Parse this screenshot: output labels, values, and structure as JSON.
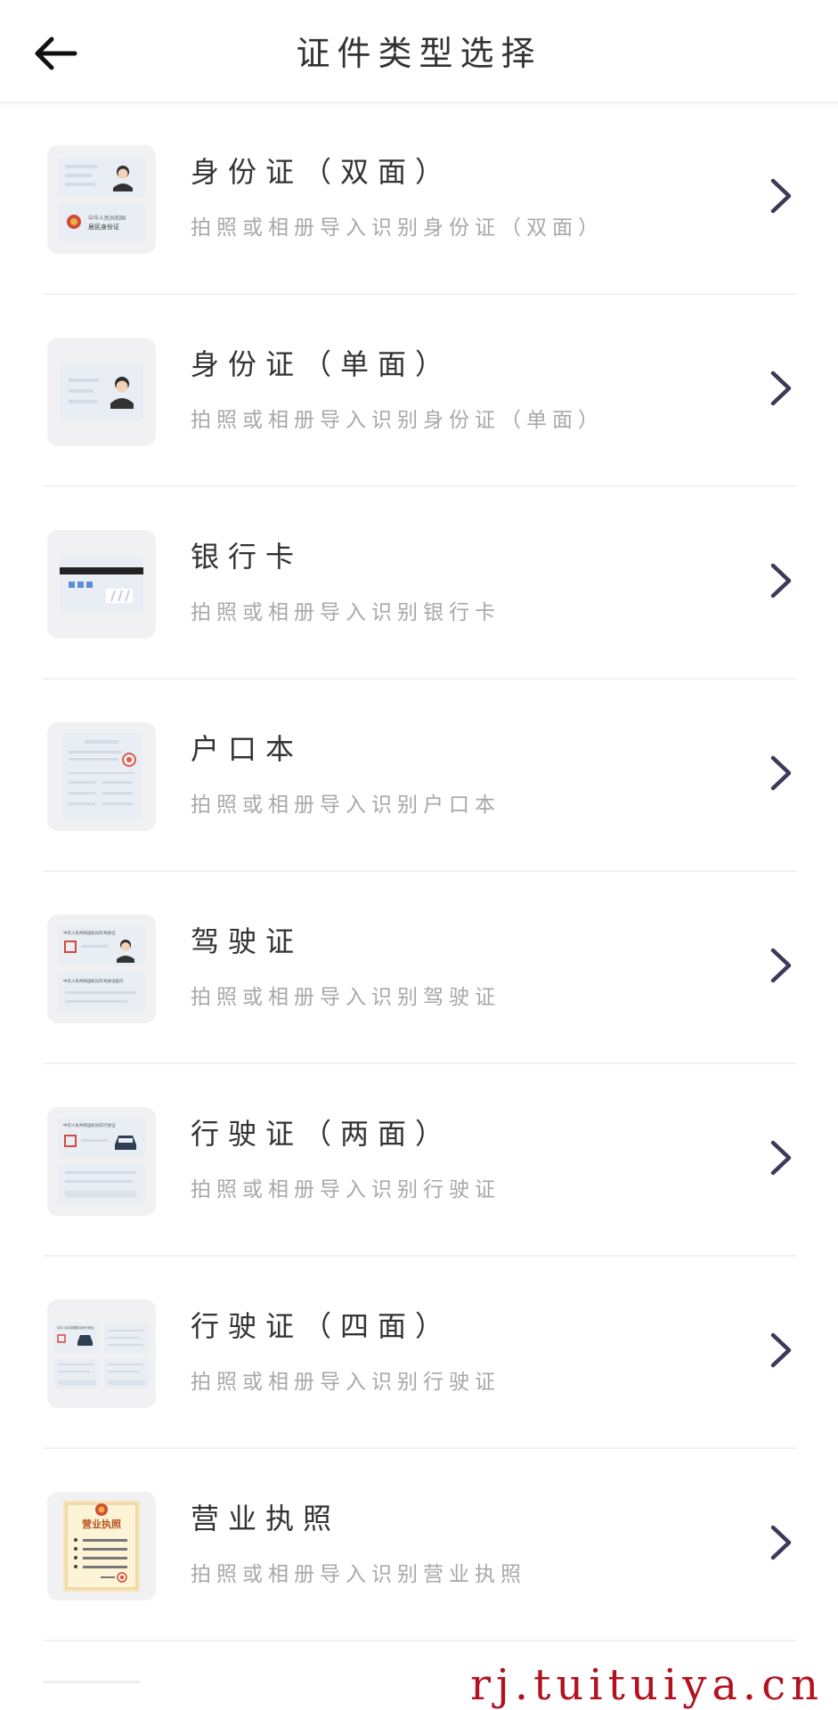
{
  "header": {
    "title": "证件类型选择",
    "back_icon": "arrow-left-icon"
  },
  "items": [
    {
      "id": "id-double",
      "title": "身份证（双面）",
      "subtitle": "拍照或相册导入识别身份证（双面）",
      "icon": "id-card-double-icon"
    },
    {
      "id": "id-single",
      "title": "身份证（单面）",
      "subtitle": "拍照或相册导入识别身份证（单面）",
      "icon": "id-card-single-icon"
    },
    {
      "id": "bank-card",
      "title": "银行卡",
      "subtitle": "拍照或相册导入识别银行卡",
      "icon": "bank-card-icon"
    },
    {
      "id": "household",
      "title": "户口本",
      "subtitle": "拍照或相册导入识别户口本",
      "icon": "household-register-icon"
    },
    {
      "id": "driver-license",
      "title": "驾驶证",
      "subtitle": "拍照或相册导入识别驾驶证",
      "icon": "driver-license-icon"
    },
    {
      "id": "vehicle-two",
      "title": "行驶证（两面）",
      "subtitle": "拍照或相册导入识别行驶证",
      "icon": "vehicle-license-two-icon"
    },
    {
      "id": "vehicle-four",
      "title": "行驶证（四面）",
      "subtitle": "拍照或相册导入识别行驶证",
      "icon": "vehicle-license-four-icon"
    },
    {
      "id": "business",
      "title": "营业执照",
      "subtitle": "拍照或相册导入识别营业执照",
      "icon": "business-license-icon"
    }
  ],
  "thumb_text": {
    "id_front_line1": "中华人民共和国",
    "id_front_line2": "居民身份证",
    "driver_line1": "中华人民共和国机动车驾驶证",
    "driver_line2": "中华人民共和国机动车驾驶证副页",
    "vehicle_line1": "中华人民共和国机动车行驶证",
    "vehicle4_line1": "中华人民共和国机动车行驶证",
    "business_label": "营业执照"
  },
  "watermark": "rj.tuituiya.cn",
  "colors": {
    "chevron": "#3a3a5a",
    "watermark": "#b2121f",
    "subtitle": "#a8a8a8"
  }
}
